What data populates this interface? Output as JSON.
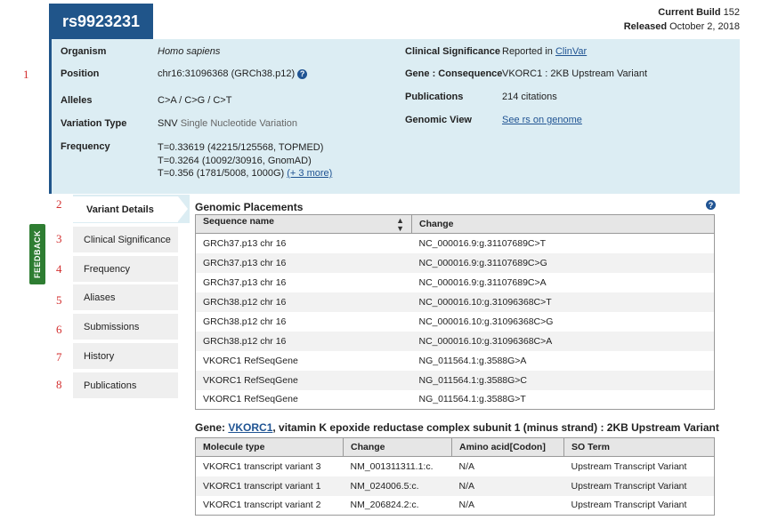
{
  "title": "rs9923231",
  "build": {
    "label": "Current Build",
    "value": "152",
    "released_label": "Released",
    "released_value": "October 2, 2018"
  },
  "summary": {
    "organism_label": "Organism",
    "organism": "Homo sapiens",
    "position_label": "Position",
    "position": "chr16:31096368 (GRCh38.p12)",
    "alleles_label": "Alleles",
    "alleles": "C>A / C>G / C>T",
    "variation_type_label": "Variation Type",
    "variation_type": "SNV",
    "variation_type_desc": "Single Nucleotide Variation",
    "frequency_label": "Frequency",
    "frequency": [
      "T=0.33619 (42215/125568, TOPMED)",
      "T=0.3264 (10092/30916, GnomAD)",
      "T=0.356 (1781/5008, 1000G)"
    ],
    "frequency_more": "(+ 3 more)",
    "clinical_label": "Clinical Significance",
    "clinical_prefix": "Reported in",
    "clinical_link": "ClinVar",
    "gene_label": "Gene : Consequence",
    "gene": "VKORC1 : 2KB Upstream Variant",
    "publications_label": "Publications",
    "publications": "214 citations",
    "genomic_view_label": "Genomic View",
    "genomic_view_link": "See rs on genome"
  },
  "annotations": [
    "1",
    "2",
    "3",
    "4",
    "5",
    "6",
    "7",
    "8"
  ],
  "feedback_label": "FEEDBACK",
  "nav": [
    "Variant Details",
    "Clinical Significance",
    "Frequency",
    "Aliases",
    "Submissions",
    "History",
    "Publications"
  ],
  "placements": {
    "title": "Genomic Placements",
    "headers": [
      "Sequence name",
      "Change"
    ],
    "rows": [
      [
        "GRCh37.p13 chr 16",
        "NC_000016.9:g.31107689C>T"
      ],
      [
        "GRCh37.p13 chr 16",
        "NC_000016.9:g.31107689C>G"
      ],
      [
        "GRCh37.p13 chr 16",
        "NC_000016.9:g.31107689C>A"
      ],
      [
        "GRCh38.p12 chr 16",
        "NC_000016.10:g.31096368C>T"
      ],
      [
        "GRCh38.p12 chr 16",
        "NC_000016.10:g.31096368C>G"
      ],
      [
        "GRCh38.p12 chr 16",
        "NC_000016.10:g.31096368C>A"
      ],
      [
        "VKORC1 RefSeqGene",
        "NG_011564.1:g.3588G>A"
      ],
      [
        "VKORC1 RefSeqGene",
        "NG_011564.1:g.3588G>C"
      ],
      [
        "VKORC1 RefSeqGene",
        "NG_011564.1:g.3588G>T"
      ]
    ]
  },
  "gene_section": {
    "prefix": "Gene:",
    "gene_link": "VKORC1",
    "suffix": ", vitamin K epoxide reductase complex subunit 1 (minus strand) : 2KB Upstream Variant",
    "headers": [
      "Molecule type",
      "Change",
      "Amino acid[Codon]",
      "SO Term"
    ],
    "rows": [
      [
        "VKORC1 transcript variant 3",
        "NM_001311311.1:c.",
        "N/A",
        "Upstream Transcript Variant"
      ],
      [
        "VKORC1 transcript variant 1",
        "NM_024006.5:c.",
        "N/A",
        "Upstream Transcript Variant"
      ],
      [
        "VKORC1 transcript variant 2",
        "NM_206824.2:c.",
        "N/A",
        "Upstream Transcript Variant"
      ]
    ]
  },
  "colors": {
    "header_blue": "#20558a",
    "summary_bg": "#dcedf3",
    "feedback_green": "#2e7d32",
    "annotation_red": "#d32f2f"
  }
}
